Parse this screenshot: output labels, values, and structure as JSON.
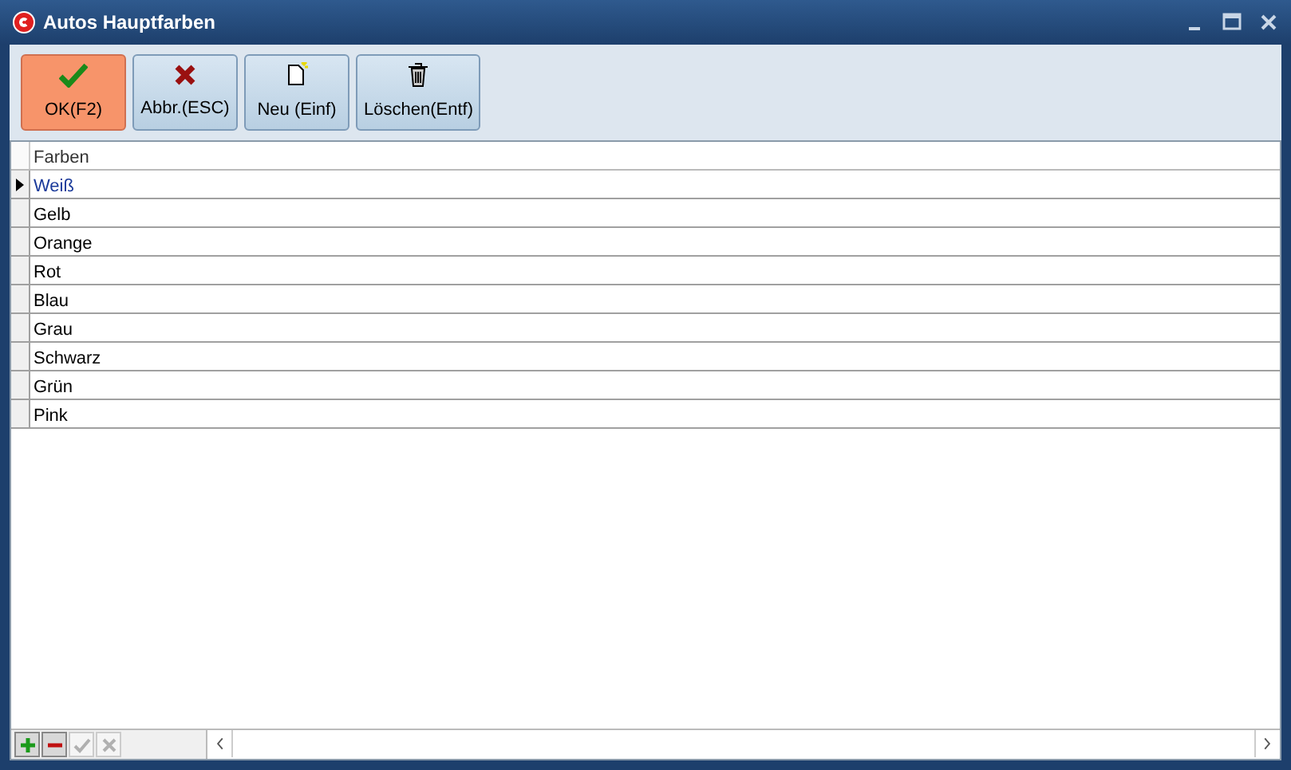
{
  "window": {
    "title": "Autos Hauptfarben"
  },
  "toolbar": [
    {
      "kind": "ok",
      "label": "OK(F2)",
      "selected": true
    },
    {
      "kind": "cancel",
      "label": "Abbr.(ESC)",
      "selected": false
    },
    {
      "kind": "new",
      "label": "Neu (Einf)",
      "selected": false
    },
    {
      "kind": "delete",
      "label": "Löschen(Entf)",
      "selected": false
    }
  ],
  "table": {
    "columns": [
      "Farben"
    ],
    "rows": [
      {
        "cell": "Weiß",
        "selected": true
      },
      {
        "cell": "Gelb",
        "selected": false
      },
      {
        "cell": "Orange",
        "selected": false
      },
      {
        "cell": "Rot",
        "selected": false
      },
      {
        "cell": "Blau",
        "selected": false
      },
      {
        "cell": "Grau",
        "selected": false
      },
      {
        "cell": "Schwarz",
        "selected": false
      },
      {
        "cell": "Grün",
        "selected": false
      },
      {
        "cell": "Pink",
        "selected": false
      }
    ]
  },
  "navigator": [
    {
      "kind": "add",
      "disabled": false
    },
    {
      "kind": "remove",
      "disabled": false
    },
    {
      "kind": "post",
      "disabled": true
    },
    {
      "kind": "cancel",
      "disabled": true
    }
  ]
}
